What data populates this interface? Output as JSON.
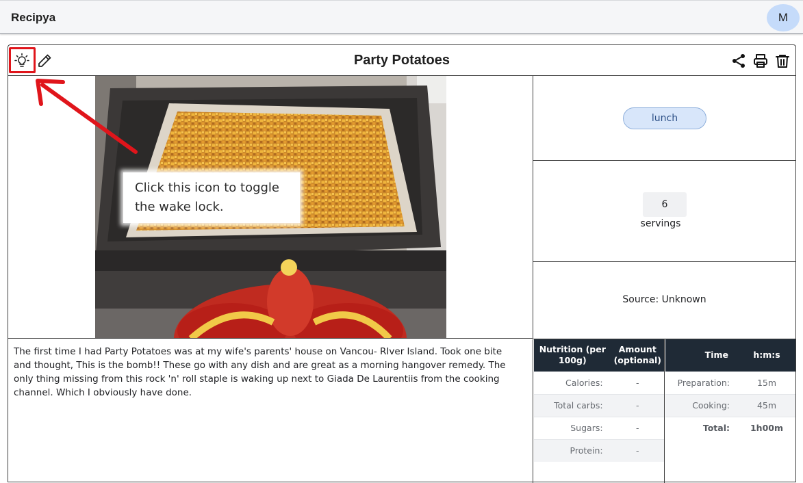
{
  "app": {
    "title": "Recipya",
    "avatar_initial": "M"
  },
  "recipe": {
    "title": "Party Potatoes",
    "category": "lunch",
    "servings_value": "6",
    "servings_label": "servings",
    "source": "Source: Unknown",
    "description": "The first time I had Party Potatoes was at my wife's parents' house on Vancou- RIver Island. Took one bite and thought, This is the bomb!! These go with any dish and are great as a morning hangover remedy. The only thing missing from this rock 'n' roll staple is waking up next to Giada De Laurentiis from the cooking channel. Which I obviously have done."
  },
  "callout": {
    "text": "Click this icon to toggle the wake lock."
  },
  "toolbar": {
    "left_icons": [
      "lightbulb-icon",
      "pencil-icon"
    ],
    "right_icons": [
      "share-icon",
      "printer-icon",
      "trash-icon"
    ]
  },
  "nutrition": {
    "header_col1": "Nutrition (per 100g)",
    "header_col2": "Amount (optional)",
    "rows": [
      {
        "label": "Calories:",
        "value": "-"
      },
      {
        "label": "Total carbs:",
        "value": "-"
      },
      {
        "label": "Sugars:",
        "value": "-"
      },
      {
        "label": "Protein:",
        "value": "-"
      }
    ]
  },
  "times": {
    "header_col1": "Time",
    "header_col2": "h:m:s",
    "rows": [
      {
        "label": "Preparation:",
        "value": "15m"
      },
      {
        "label": "Cooking:",
        "value": "45m"
      },
      {
        "label": "Total:",
        "value": "1h00m"
      }
    ]
  },
  "colors": {
    "annotation_red": "#e0151b",
    "chip_bg": "#d8e6fa",
    "avatar_bg": "#c5dbfa",
    "table_header_bg": "#1f2a36"
  }
}
